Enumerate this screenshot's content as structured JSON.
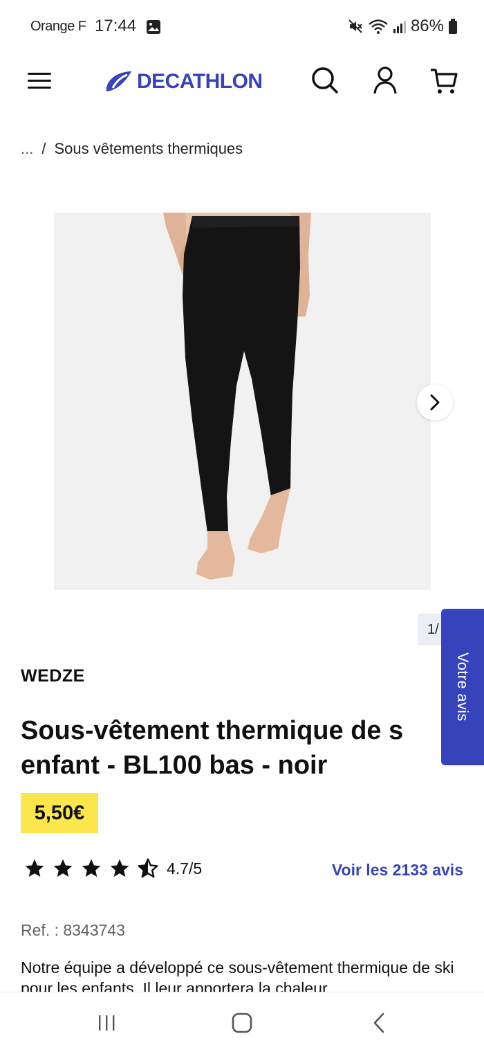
{
  "status_bar": {
    "carrier": "Orange F",
    "time": "17:44",
    "battery": "86%",
    "icons": [
      "gallery-icon",
      "mute-icon",
      "wifi-icon",
      "signal-icon",
      "battery-icon"
    ]
  },
  "header": {
    "logo_text": "DECATHLON",
    "icons": [
      "menu-icon",
      "search-icon",
      "account-icon",
      "cart-icon"
    ]
  },
  "breadcrumb": {
    "ellipsis": "...",
    "separator": "/",
    "current": "Sous vêtements thermiques"
  },
  "gallery": {
    "pager": "1/"
  },
  "feedback_tab": {
    "label": "Votre avis"
  },
  "product": {
    "brand": "WEDZE",
    "title_line1": "Sous-vêtement thermique de s",
    "title_line2": "enfant - BL100 bas - noir",
    "price": "5,50€",
    "rating": {
      "value": 4.7,
      "label": "4.7/5",
      "stars": [
        "full",
        "full",
        "full",
        "full",
        "half"
      ]
    },
    "reviews_link": "Voir les 2133 avis",
    "ref": "Ref. : 8343743",
    "description": "Notre équipe a développé ce sous-vêtement thermique de ski pour les enfants. Il leur apportera la chaleur"
  },
  "colors": {
    "brand_blue": "#3643ba",
    "price_yellow": "#fbe64d"
  },
  "nav_bar": {
    "buttons": [
      "recents-icon",
      "home-icon",
      "back-icon"
    ]
  }
}
